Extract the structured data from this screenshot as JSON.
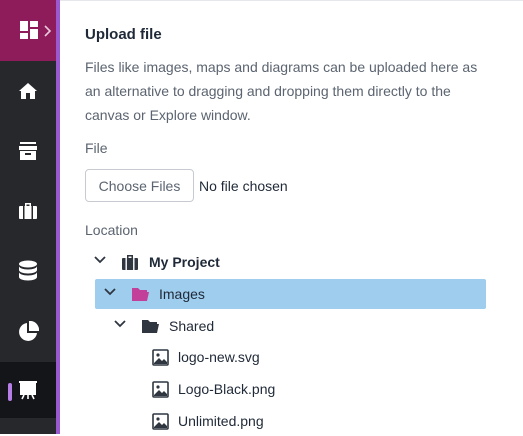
{
  "sidebar": {
    "logo_icon": "dashboard-grid-icon",
    "expand_icon": "chevron-right-icon",
    "items": [
      {
        "icon": "home-icon"
      },
      {
        "icon": "archive-icon"
      },
      {
        "icon": "briefcase-icon"
      },
      {
        "icon": "database-icon"
      },
      {
        "icon": "pie-chart-icon"
      },
      {
        "icon": "presentation-icon",
        "active": true
      }
    ],
    "colors": {
      "background": "#26282c",
      "logo": "#8e1c5b",
      "accent": "#9b59d0",
      "active": "#141518"
    }
  },
  "upload": {
    "title": "Upload file",
    "description": "Files like images, maps and diagrams can be uploaded here as an alternative to dragging and dropping them directly to the canvas or Explore window.",
    "file_label": "File",
    "choose_button": "Choose Files",
    "file_status": "No file chosen",
    "location_label": "Location"
  },
  "tree": [
    {
      "label": "My Project",
      "icon": "briefcase-icon",
      "expanded": true,
      "bold": true
    },
    {
      "label": "Images",
      "icon": "folder-open-icon",
      "expanded": true,
      "selected": true
    },
    {
      "label": "Shared",
      "icon": "folder-open-icon",
      "expanded": true
    },
    {
      "label": "logo-new.svg",
      "icon": "image-icon"
    },
    {
      "label": "Logo-Black.png",
      "icon": "image-icon"
    },
    {
      "label": "Unlimited.png",
      "icon": "image-icon"
    }
  ],
  "colors": {
    "selection": "#9ecdee",
    "folder_selected": "#c2409a",
    "folder": "#2f3640"
  }
}
